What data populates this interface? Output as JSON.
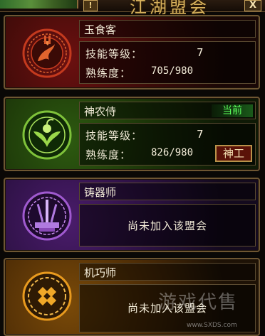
{
  "header": {
    "title": "江湖盟会",
    "info_label": "!",
    "close_label": "X"
  },
  "cards": [
    {
      "name": "玉食客",
      "level_label": "技能等级：",
      "level": "7",
      "prof_label": "熟练度：",
      "prof": "705/980",
      "emblem": "dragon-emblem-icon",
      "accent": "#c43a1e"
    },
    {
      "name": "神农侍",
      "badge": "当前",
      "level_label": "技能等级：",
      "level": "7",
      "prof_label": "熟练度：",
      "prof": "826/980",
      "button": "神工",
      "emblem": "herb-emblem-icon",
      "accent": "#7fc23a"
    },
    {
      "name": "铸器师",
      "status": "尚未加入该盟会",
      "emblem": "forge-emblem-icon",
      "accent": "#a05ad0"
    },
    {
      "name": "机巧师",
      "status": "尚未加入该盟会",
      "emblem": "mechanism-emblem-icon",
      "accent": "#e89a1e"
    }
  ],
  "watermark": {
    "text": "游戏代售",
    "site": "www.SXDS.com"
  }
}
